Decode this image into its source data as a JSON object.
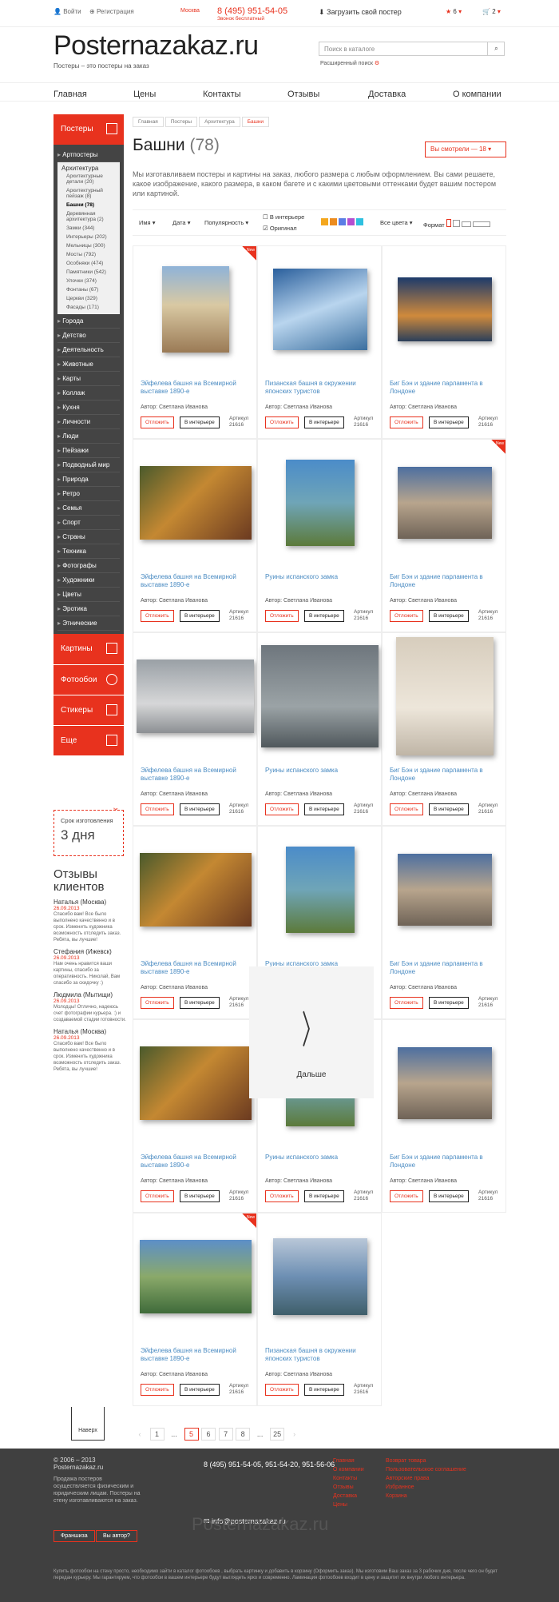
{
  "top": {
    "login": "Войти",
    "register": "Регистрация",
    "city": "Москва",
    "phone": "8 (495) 951-54-05",
    "phone_note": "Звонок бесплатный",
    "upload": "Загрузить свой постер",
    "fav": "6",
    "cart": "2"
  },
  "brand": {
    "name": "Posternazakaz.ru",
    "sub": "Постеры – это постеры на заказ"
  },
  "search": {
    "placeholder": "Поиск в каталоге",
    "adv": "Расширенный поиск"
  },
  "nav": [
    "Главная",
    "Цены",
    "Контакты",
    "Отзывы",
    "Доставка",
    "О компании"
  ],
  "side": {
    "posters": "Постеры",
    "art": "Артпостеры",
    "arch": "Архитектура",
    "subs": [
      "Архитектурные детали (20)",
      "Архитектурный пейзаж (8)",
      "Башни (78)",
      "Деревянная архитектура (2)",
      "Замки (344)",
      "Интерьеры (202)",
      "Мельницы (300)",
      "Мосты (792)",
      "Особняки (474)",
      "Памятники (542)",
      "Улочки (374)",
      "Фонтаны (67)",
      "Церкви (329)",
      "Фасады (171)"
    ],
    "cats": [
      "Города",
      "Детство",
      "Деятельность",
      "Животные",
      "Карты",
      "Коллаж",
      "Кухня",
      "Личности",
      "Люди",
      "Пейзажи",
      "Подводный мир",
      "Природа",
      "Ретро",
      "Семья",
      "Спорт",
      "Страны",
      "Техника",
      "Фотографы",
      "Художники",
      "Цветы",
      "Эротика",
      "Этнические"
    ],
    "bigs": [
      "Картины",
      "Фотообои",
      "Стикеры",
      "Еще"
    ]
  },
  "term": {
    "label": "Срок изготовления",
    "value": "3 дня"
  },
  "reviews": {
    "title": "Отзывы клиентов",
    "items": [
      {
        "n": "Наталья (Москва)",
        "d": "26.09.2013",
        "t": "Спасибо вам! Все было выполнено качественно и в срок. Изменить художника возможность отследить заказ. Ребята, вы лучшие!"
      },
      {
        "n": "Стефания (Ижевск)",
        "d": "26.09.2013",
        "t": "Нам очень нравится ваши картины, спасибо за оперативность. Николай, Вам спасибо за скидочку :)"
      },
      {
        "n": "Людмила (Мытищи)",
        "d": "26.09.2013",
        "t": "Молодцы! Отлично, надеюсь счет фотографии курьера. :) и создаваемой стадии готовности."
      },
      {
        "n": "Наталья (Москва)",
        "d": "26.09.2013",
        "t": "Спасибо вам! Все было выполнено качественно и в срок. Изменить художника возможность отследить заказ. Ребята, вы лучшие!"
      }
    ]
  },
  "up": "Наверх",
  "crumbs": [
    "Главная",
    "Постеры",
    "Архитектура",
    "Башни"
  ],
  "title": "Башни",
  "count": "(78)",
  "seen": "Вы смотрели — 18",
  "desc": "Мы изготавливаем постеры и картины на заказ, любого размера с любым оформлением. Вы сами решаете, какое изображение, какого размера, в каком багете и с какими цветовыми оттенками будет вашим постером или картиной.",
  "filters": {
    "name": "Имя",
    "date": "Дата",
    "pop": "Популярность",
    "interior": "В интерьере",
    "orig": "Оригинал",
    "colors": "Все цвета",
    "format": "Формат"
  },
  "t1": "Эйфелева башня на Всемирной выставке 1890-е",
  "t2": "Пизанская башня в окружении японских туристов",
  "t3": "Биг Бэн и здание парламента в Лондоне",
  "t4": "Руины испанского замка",
  "author": "Автор: Светлана Иванова",
  "defer": "Отложить",
  "inint": "В интерьере",
  "art": "Артикул 21616",
  "newb": "New",
  "more": "Дальше",
  "pages": [
    "1",
    "...",
    "5",
    "6",
    "7",
    "8",
    "...",
    "25"
  ],
  "foot": {
    "copy": "© 2006 – 2013 Posternazakaz.ru",
    "copy2": "Продажа постеров осуществляется физическим и юридическим лицам. Постеры на стену изготавливаются на заказ.",
    "phones": "8 (495) 951-54-05, 951-54-20, 951-56-06",
    "mail": "info@posternazakaz.ru",
    "fr": "Франшиза",
    "author": "Вы автор?",
    "l1": [
      "Главная",
      "О компании",
      "Контакты",
      "Отзывы",
      "Доставка",
      "Цены"
    ],
    "l2": [
      "Возврат товара",
      "Пользовательское соглашение",
      "Авторские права",
      "Избранное",
      "Корзина"
    ],
    "wm": "Posternazakaz.ru",
    "bottom": "Купить фотообои на стену просто, необходимо зайти в каталог фотообоев , выбрать картинку и добавить в корзину (Оформить заказ). Мы изготовим Ваш заказ за 3 рабочих дня, после чего он будет передан курьеру. Мы гарантируем, что фотообои в вашем интерьере будут выглядеть ярко и современно. Ламинация фотообоев входит в цену и защитит их внутри любого интерьера."
  }
}
